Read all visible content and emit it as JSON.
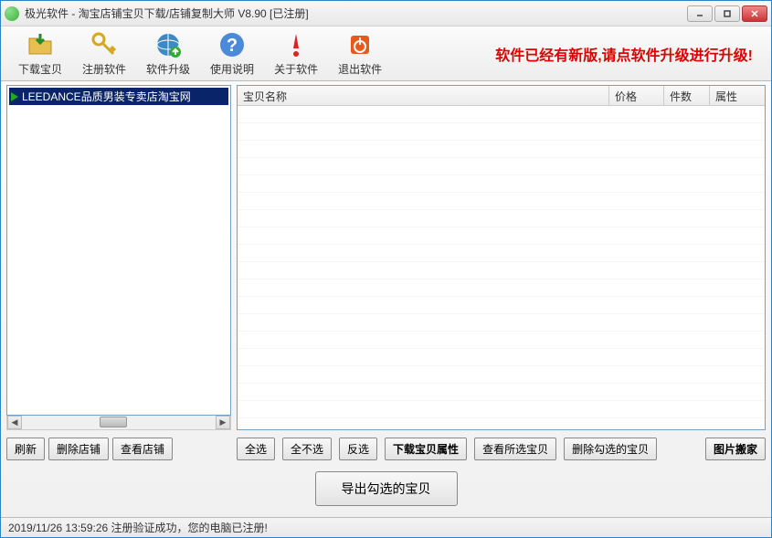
{
  "window": {
    "title": "极光软件 - 淘宝店铺宝贝下载/店铺复制大师 V8.90 [已注册]"
  },
  "toolbar": {
    "download": "下载宝贝",
    "register": "注册软件",
    "upgrade": "软件升级",
    "help": "使用说明",
    "about": "关于软件",
    "exit": "退出软件"
  },
  "banner": "软件已经有新版,请点软件升级进行升级!",
  "tree": {
    "item1": "LEEDANCE品质男装专卖店淘宝网"
  },
  "left_buttons": {
    "refresh": "刷新",
    "delete_shop": "删除店铺",
    "view_shop": "查看店铺"
  },
  "grid": {
    "columns": {
      "name": "宝贝名称",
      "price": "价格",
      "count": "件数",
      "attr": "属性"
    }
  },
  "right_buttons": {
    "select_all": "全选",
    "select_none": "全不选",
    "invert": "反选",
    "download_attr": "下载宝贝属性",
    "view_selected": "查看所选宝贝",
    "delete_checked": "删除勾选的宝贝",
    "image_move": "图片搬家"
  },
  "export_button": "导出勾选的宝贝",
  "status": "2019/11/26 13:59:26  注册验证成功，您的电脑已注册!"
}
